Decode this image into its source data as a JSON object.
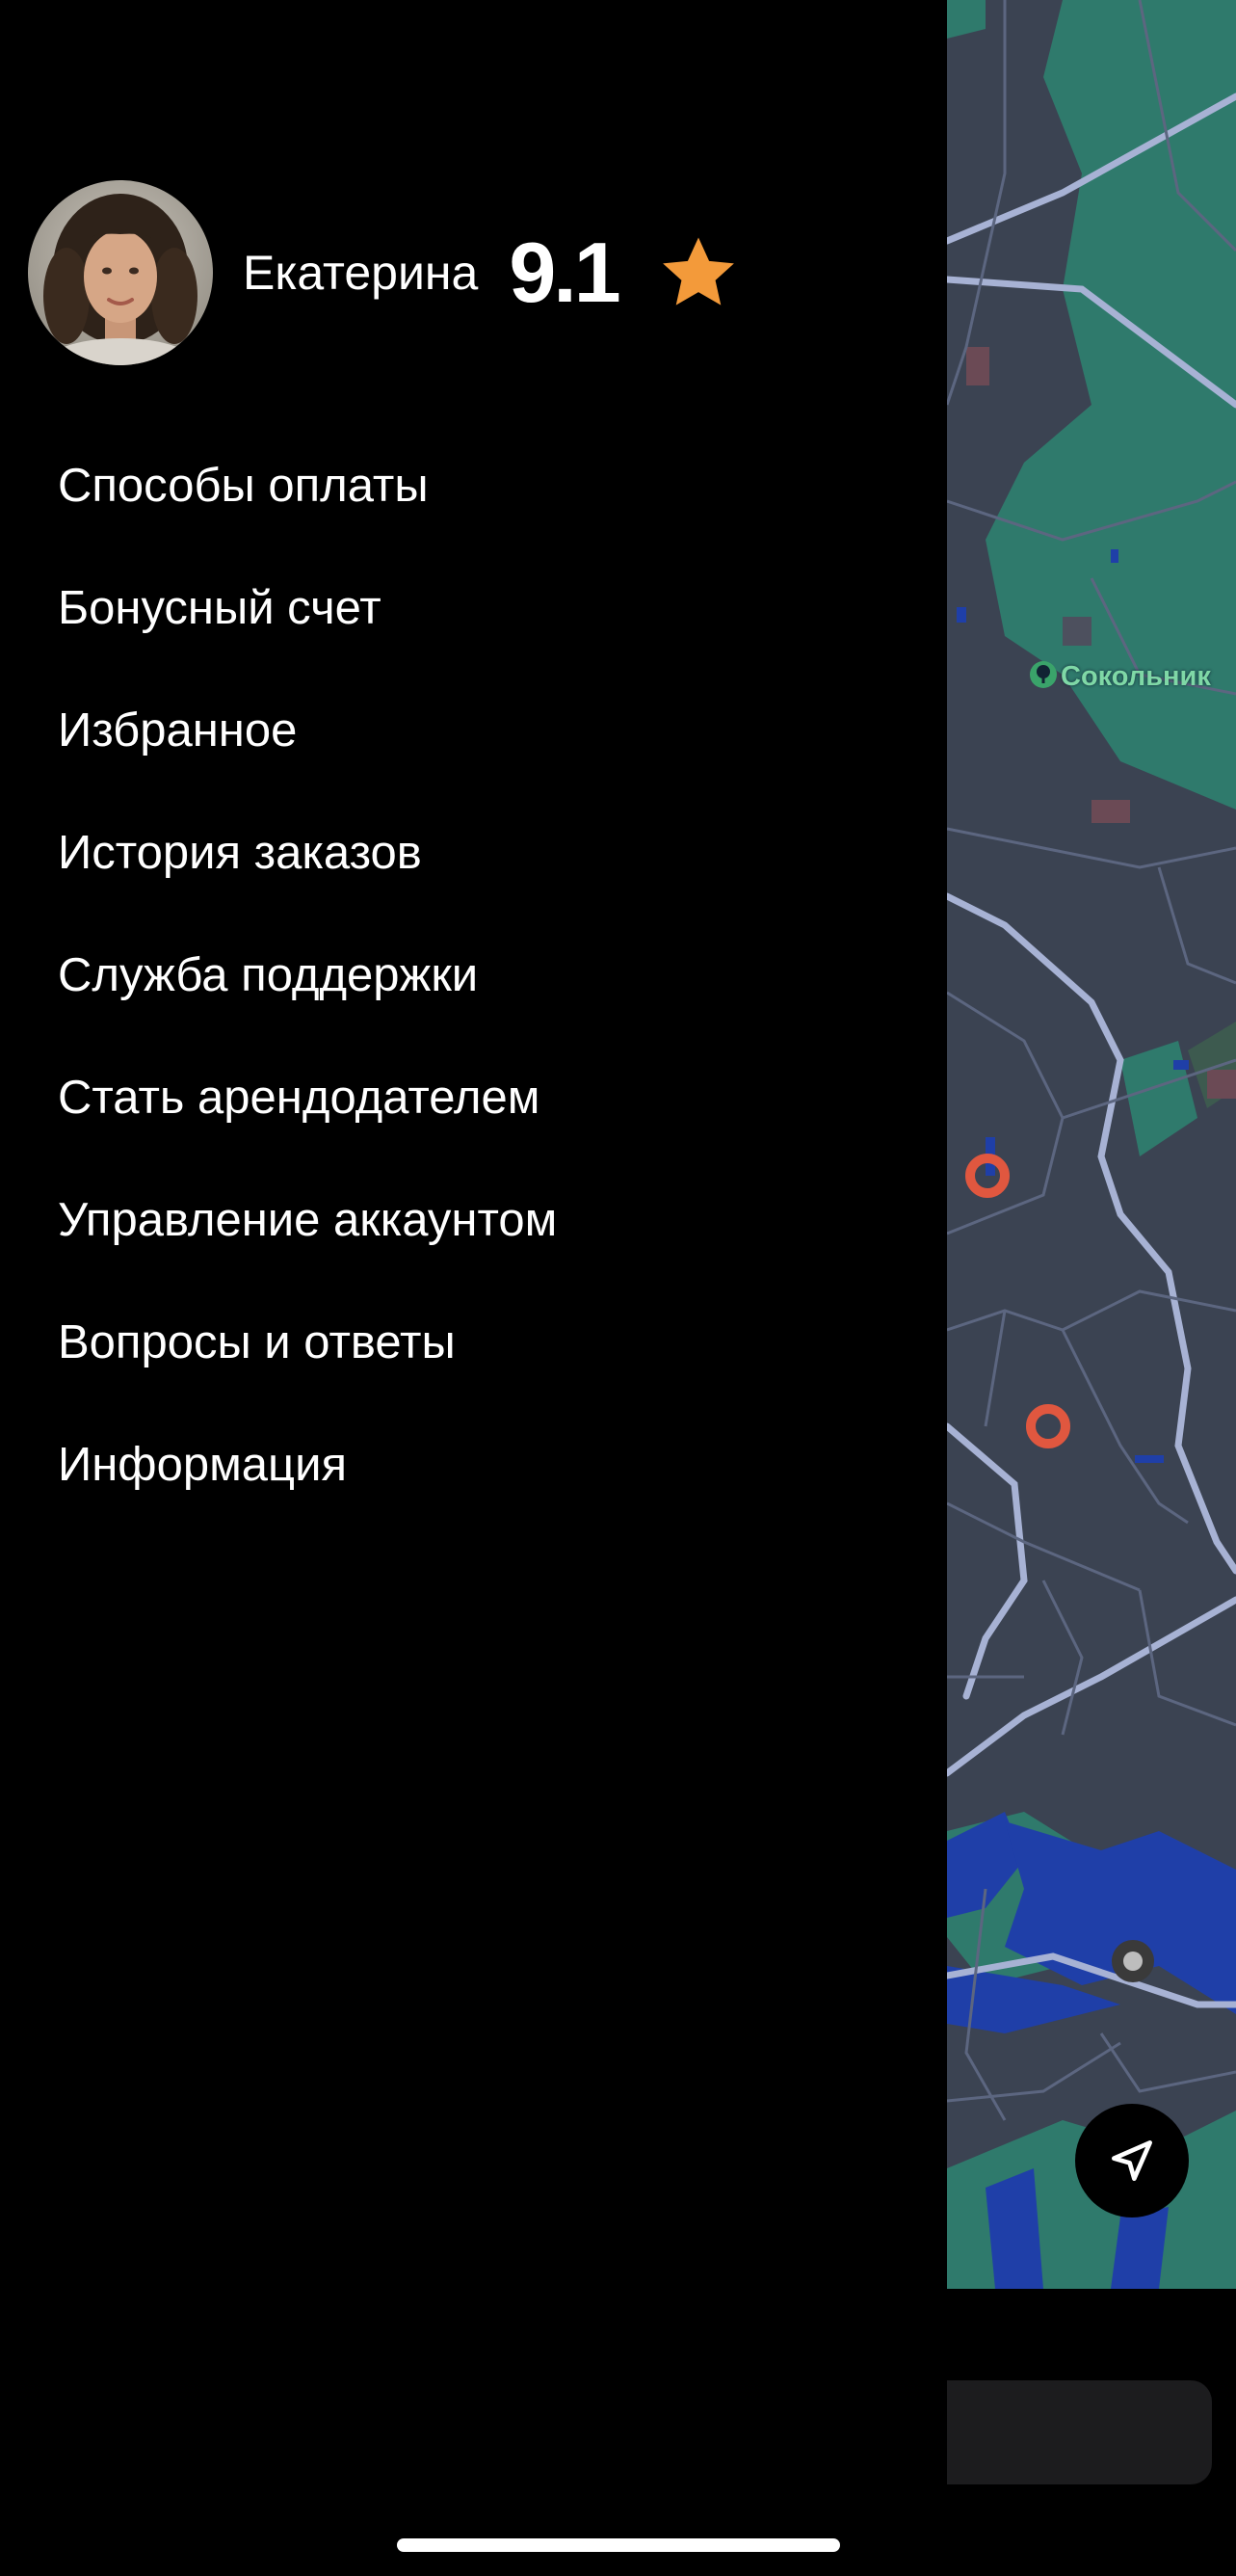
{
  "profile": {
    "name": "Екатерина",
    "rating": "9.1",
    "rating_icon": "star-icon",
    "avatar_icon": "avatar-photo"
  },
  "menu": {
    "items": [
      {
        "label": "Способы оплаты"
      },
      {
        "label": "Бонусный счет"
      },
      {
        "label": "Избранное"
      },
      {
        "label": "История заказов"
      },
      {
        "label": "Служба поддержки"
      },
      {
        "label": "Стать арендодателем"
      },
      {
        "label": "Управление аккаунтом"
      },
      {
        "label": "Вопросы и ответы"
      },
      {
        "label": "Информация"
      }
    ]
  },
  "map": {
    "poi_label": "Сокольник",
    "poi_icon": "park-icon",
    "locate_icon": "navigation-arrow-icon"
  },
  "colors": {
    "accent_star": "#f39a3a",
    "map_background": "#3b4352",
    "map_park": "#2f7a6c",
    "map_water": "#1f3fa8",
    "map_marker": "#e0573f",
    "drawer_background": "#000000"
  }
}
